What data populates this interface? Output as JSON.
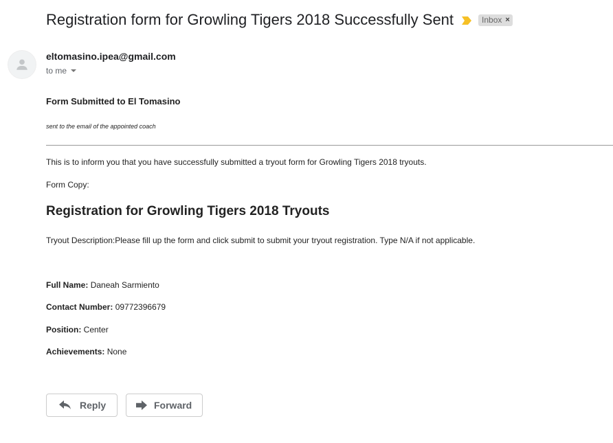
{
  "email": {
    "subject": "Registration form for Growling Tigers 2018 Successfully Sent",
    "label": "Inbox",
    "label_remove": "×",
    "sender": "eltomasino.ipea@gmail.com",
    "recipient": "to me",
    "colors": {
      "importance": "#f6c026",
      "label_bg": "#dddddd"
    }
  },
  "body": {
    "heading": "Form Submitted to El Tomasino",
    "note": "sent to the email of the appointed coach",
    "intro": "This is to inform you that you have successfully submitted a tryout form for Growling Tigers 2018 tryouts.",
    "form_copy": "Form Copy:",
    "title": "Registration for Growling Tigers 2018 Tryouts",
    "description": "Tryout Description:Please fill up the form and click submit to submit your tryout registration. Type N/A if not applicable.",
    "fields": [
      {
        "label": "Full Name:",
        "value": "Daneah Sarmiento"
      },
      {
        "label": "Contact Number:",
        "value": "09772396679"
      },
      {
        "label": "Position:",
        "value": "Center"
      },
      {
        "label": "Achievements:",
        "value": "None"
      }
    ]
  },
  "actions": {
    "reply_label": "Reply",
    "forward_label": "Forward",
    "icons": [
      "reply-icon",
      "forward-icon",
      "importance-icon",
      "avatar-person-icon",
      "dropdown-caret-icon"
    ]
  }
}
